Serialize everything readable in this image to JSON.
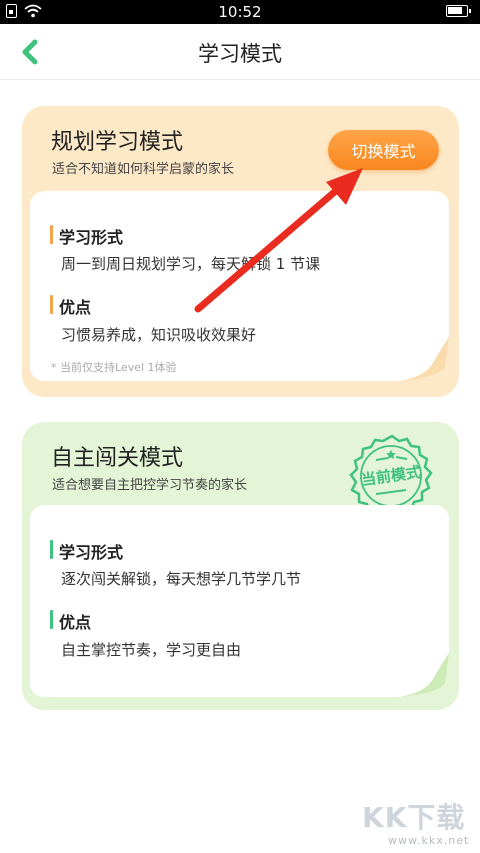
{
  "status_bar": {
    "time": "10:52"
  },
  "nav": {
    "title": "学习模式"
  },
  "plan_mode": {
    "title": "规划学习模式",
    "desc": "适合不知道如何科学启蒙的家长",
    "switch_button": "切换模式",
    "form_heading": "学习形式",
    "form_text": "周一到周日规划学习，每天解锁 1 节课",
    "merit_heading": "优点",
    "merit_text": "习惯易养成，知识吸收效果好",
    "footnote": "* 当前仅支持Level 1体验"
  },
  "free_mode": {
    "title": "自主闯关模式",
    "desc": "适合想要自主把控学习节奏的家长",
    "stamp": "当前模式",
    "form_heading": "学习形式",
    "form_text": "逐次闯关解锁，每天想学几节学几节",
    "merit_heading": "优点",
    "merit_text": "自主掌控节奏，学习更自由"
  },
  "watermark": {
    "logo": "KK下载",
    "url": "www.kkx.net"
  },
  "colors": {
    "accent_green": "#3fc27d",
    "accent_orange": "#f8871e",
    "arrow_red": "#ea2b1f"
  }
}
